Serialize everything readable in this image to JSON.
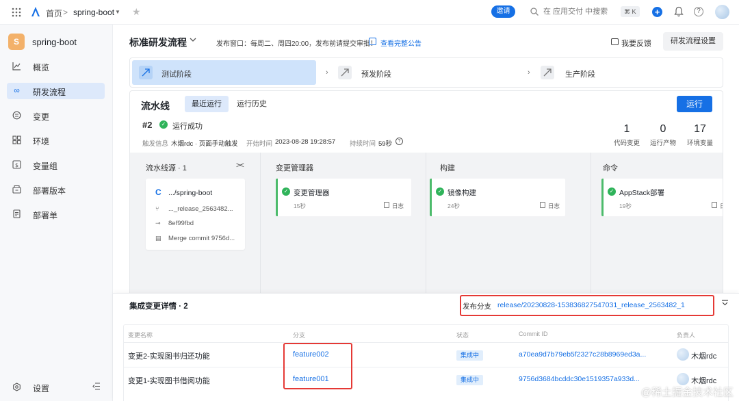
{
  "topbar": {
    "home": "首页",
    "separator": ">",
    "project": "spring-boot",
    "invite": "邀请",
    "search_placeholder": "在 应用交付 中搜索",
    "shortcut": "⌘ K"
  },
  "sidebar": {
    "project_initial": "S",
    "project_name": "spring-boot",
    "items": [
      {
        "label": "概览",
        "icon": "chart-line-icon"
      },
      {
        "label": "研发流程",
        "icon": "infinity-icon",
        "active": true
      },
      {
        "label": "变更",
        "icon": "change-icon"
      },
      {
        "label": "环境",
        "icon": "grid-icon"
      },
      {
        "label": "变量组",
        "icon": "dollar-icon"
      },
      {
        "label": "部署版本",
        "icon": "package-icon"
      },
      {
        "label": "部署单",
        "icon": "document-icon"
      }
    ],
    "settings": "设置"
  },
  "header": {
    "title": "标准研发流程",
    "notice": "发布窗口：每周二、周四20:00，发布前请提交审批！",
    "notice_link": "查看完整公告",
    "feedback": "我要反馈",
    "settings_button": "研发流程设置"
  },
  "stages": [
    {
      "label": "测试阶段",
      "active": true
    },
    {
      "label": "预发阶段",
      "active": false
    },
    {
      "label": "生产阶段",
      "active": false
    }
  ],
  "pipeline": {
    "title": "流水线",
    "tabs": [
      "最近运行",
      "运行历史"
    ],
    "run_button": "运行",
    "run_number": "#2",
    "run_status": "运行成功",
    "trigger_label": "触发信息",
    "trigger_value": "木烟rdc · 页面手动触发",
    "start_label": "开始时间",
    "start_value": "2023-08-28 19:28:57",
    "duration_label": "持续时间",
    "duration_value": "59秒",
    "stats": [
      {
        "value": "1",
        "label": "代码变更"
      },
      {
        "value": "0",
        "label": "运行产物"
      },
      {
        "value": "17",
        "label": "环境变量"
      }
    ],
    "source_column": {
      "title": "流水线源 · 1",
      "repo": ".../spring-boot",
      "branch": "..._release_2563482...",
      "commit": "8ef99fbd",
      "message": "Merge commit 9756d..."
    },
    "columns": [
      {
        "title": "变更管理器",
        "job": "变更管理器",
        "duration": "15秒",
        "log": "日志"
      },
      {
        "title": "构建",
        "job": "镜像构建",
        "duration": "24秒",
        "log": "日志"
      },
      {
        "title": "命令",
        "job": "AppStack部署",
        "duration": "19秒",
        "log": "日"
      }
    ]
  },
  "integration": {
    "title": "集成变更详情 · 2",
    "branch_label": "发布分支",
    "branch_value": "release/20230828-153836827547031_release_2563482_1",
    "headers": [
      "变更名称",
      "分支",
      "状态",
      "Commit ID",
      "负责人"
    ],
    "rows": [
      {
        "name": "变更2-实现图书归还功能",
        "branch": "feature002",
        "status": "集成中",
        "commit": "a70ea9d7b79eb5f2327c28b8969ed3a...",
        "owner": "木烟rdc"
      },
      {
        "name": "变更1-实现图书借阅功能",
        "branch": "feature001",
        "status": "集成中",
        "commit": "9756d3684bcddc30e1519357a933d...",
        "owner": "木烟rdc"
      }
    ]
  },
  "watermark": "@稀土掘金技术社区",
  "colors": {
    "accent": "#1670e5",
    "success": "#2fb35a",
    "highlight": "#e53935"
  }
}
